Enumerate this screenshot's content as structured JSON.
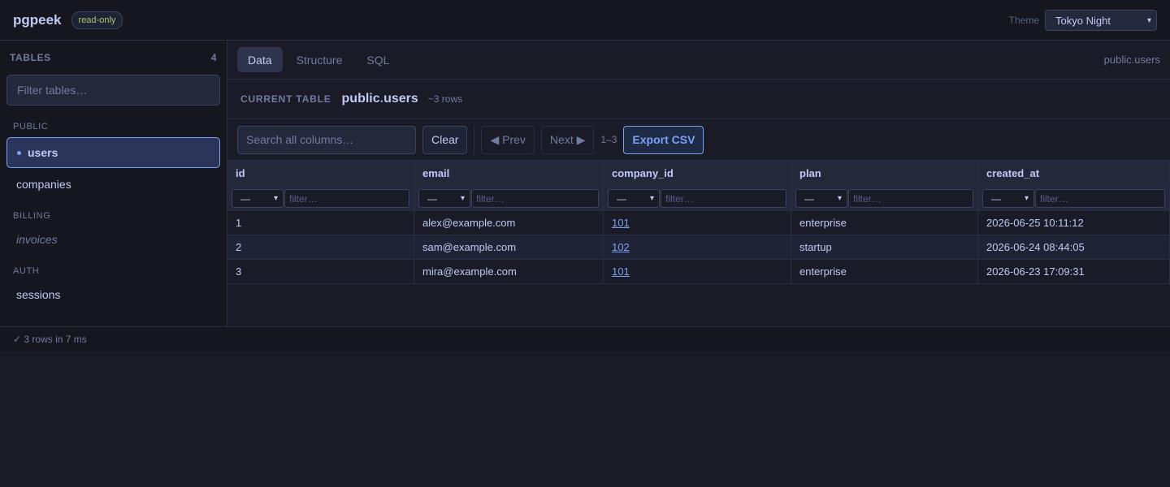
{
  "header": {
    "title": "pgpeek",
    "badge": "read-only",
    "theme_label": "Theme",
    "theme_value": "Tokyo Night"
  },
  "sidebar": {
    "heading": "TABLES",
    "count": "4",
    "filter_placeholder": "Filter tables…",
    "groups": [
      {
        "label": "PUBLIC",
        "items": [
          "users",
          "companies"
        ]
      },
      {
        "label": "BILLING",
        "items": [
          "invoices"
        ]
      },
      {
        "label": "AUTH",
        "items": [
          "sessions"
        ]
      }
    ]
  },
  "tabs": {
    "data": "Data",
    "structure": "Structure",
    "sql": "SQL",
    "right_label": "public.users"
  },
  "current_table": {
    "label": "CURRENT TABLE",
    "schema": "public",
    "separator": ".",
    "name": "users",
    "rows": "~3 rows"
  },
  "toolbar": {
    "search_placeholder": "Search all columns…",
    "clear": "Clear",
    "prev": "◀ Prev",
    "next": "Next ▶",
    "range": "1–3",
    "export": "Export CSV"
  },
  "grid": {
    "columns": [
      "id",
      "email",
      "company_id",
      "plan",
      "created_at"
    ],
    "op_default": "—",
    "filter_placeholder": "filter…",
    "rows": [
      [
        "1",
        "alex@example.com",
        "101",
        "enterprise",
        "2026-06-25 10:11:12"
      ],
      [
        "2",
        "sam@example.com",
        "102",
        "startup",
        "2026-06-24 08:44:05"
      ],
      [
        "3",
        "mira@example.com",
        "101",
        "enterprise",
        "2026-06-23 17:09:31"
      ]
    ]
  },
  "status": {
    "text": "✓ 3 rows in 7 ms"
  }
}
